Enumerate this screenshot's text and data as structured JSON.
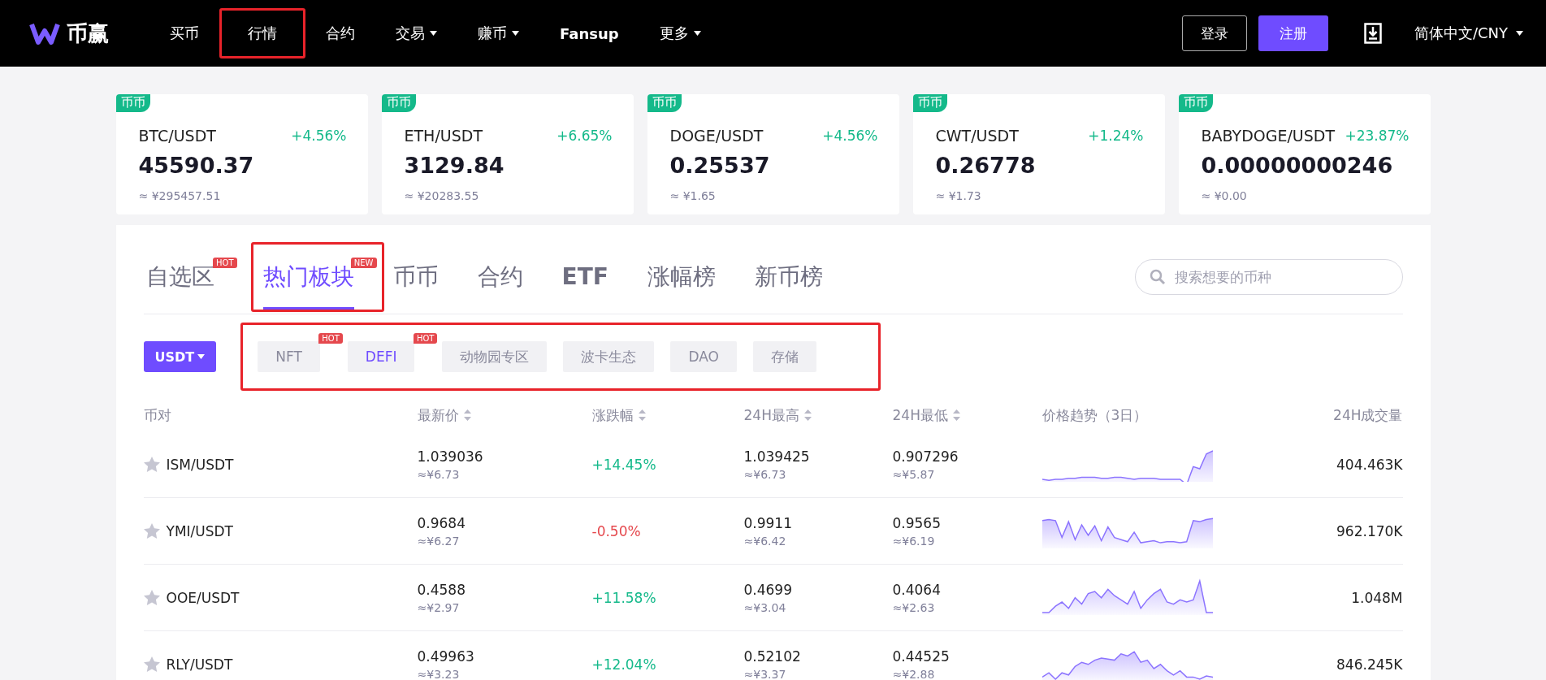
{
  "nav": {
    "logo": "币赢",
    "items": [
      {
        "label": "买币",
        "has_menu": false,
        "marked": false,
        "bold": false
      },
      {
        "label": "行情",
        "has_menu": false,
        "marked": true,
        "bold": false
      },
      {
        "label": "合约",
        "has_menu": false,
        "marked": false,
        "bold": false
      },
      {
        "label": "交易",
        "has_menu": true,
        "marked": false,
        "bold": false
      },
      {
        "label": "赚币",
        "has_menu": true,
        "marked": false,
        "bold": false
      },
      {
        "label": "Fansup",
        "has_menu": false,
        "marked": false,
        "bold": true
      },
      {
        "label": "更多",
        "has_menu": true,
        "marked": false,
        "bold": false
      }
    ],
    "login": "登录",
    "register": "注册",
    "language": "简体中文/CNY"
  },
  "tickers": [
    {
      "tag": "币币",
      "pair": "BTC/USDT",
      "change": "+4.56%",
      "price": "45590.37",
      "cny": "≈ ¥295457.51"
    },
    {
      "tag": "币币",
      "pair": "ETH/USDT",
      "change": "+6.65%",
      "price": "3129.84",
      "cny": "≈ ¥20283.55"
    },
    {
      "tag": "币币",
      "pair": "DOGE/USDT",
      "change": "+4.56%",
      "price": "0.25537",
      "cny": "≈ ¥1.65"
    },
    {
      "tag": "币币",
      "pair": "CWT/USDT",
      "change": "+1.24%",
      "price": "0.26778",
      "cny": "≈ ¥1.73"
    },
    {
      "tag": "币币",
      "pair": "BABYDOGE/USDT",
      "change": "+23.87%",
      "price": "0.00000000246",
      "cny": "≈ ¥0.00"
    }
  ],
  "tabs": [
    {
      "label": "自选区",
      "badge": "HOT",
      "selected": false,
      "marked": false,
      "bold": false
    },
    {
      "label": "热门板块",
      "badge": "NEW",
      "selected": true,
      "marked": true,
      "bold": false
    },
    {
      "label": "币币",
      "selected": false,
      "marked": false,
      "bold": false
    },
    {
      "label": "合约",
      "selected": false,
      "marked": false,
      "bold": false
    },
    {
      "label": "ETF",
      "selected": false,
      "marked": false,
      "bold": true
    },
    {
      "label": "涨幅榜",
      "selected": false,
      "marked": false,
      "bold": false
    },
    {
      "label": "新币榜",
      "selected": false,
      "marked": false,
      "bold": false
    }
  ],
  "search": {
    "placeholder": "搜索想要的币种"
  },
  "quote_selector": "USDT",
  "sectors": {
    "marked": true,
    "items": [
      {
        "label": "NFT",
        "badge": "HOT",
        "selected": false
      },
      {
        "label": "DEFI",
        "badge": "HOT",
        "selected": true
      },
      {
        "label": "动物园专区",
        "selected": false
      },
      {
        "label": "波卡生态",
        "selected": false
      },
      {
        "label": "DAO",
        "selected": false
      },
      {
        "label": "存储",
        "selected": false
      }
    ]
  },
  "table": {
    "columns": [
      {
        "label": "币对",
        "sortable": false
      },
      {
        "label": "最新价",
        "sortable": true
      },
      {
        "label": "涨跌幅",
        "sortable": true
      },
      {
        "label": "24H最高",
        "sortable": true
      },
      {
        "label": "24H最低",
        "sortable": true
      },
      {
        "label": "价格趋势（3日）",
        "sortable": false
      },
      {
        "label": "24H成交量",
        "sortable": false
      }
    ],
    "rows": [
      {
        "pair": "ISM/USDT",
        "favorite": false,
        "price": "1.039036",
        "price_cny": "≈¥6.73",
        "change": "+14.45%",
        "rising": true,
        "high": "1.039425",
        "high_cny": "≈¥6.73",
        "low": "0.907296",
        "low_cny": "≈¥5.87",
        "volume": "404.463K"
      },
      {
        "pair": "YMI/USDT",
        "favorite": false,
        "price": "0.9684",
        "price_cny": "≈¥6.27",
        "change": "-0.50%",
        "rising": false,
        "high": "0.9911",
        "high_cny": "≈¥6.42",
        "low": "0.9565",
        "low_cny": "≈¥6.19",
        "volume": "962.170K"
      },
      {
        "pair": "OOE/USDT",
        "favorite": false,
        "price": "0.4588",
        "price_cny": "≈¥2.97",
        "change": "+11.58%",
        "rising": true,
        "high": "0.4699",
        "high_cny": "≈¥3.04",
        "low": "0.4064",
        "low_cny": "≈¥2.63",
        "volume": "1.048M"
      },
      {
        "pair": "RLY/USDT",
        "favorite": false,
        "price": "0.49963",
        "price_cny": "≈¥3.23",
        "change": "+12.04%",
        "rising": true,
        "high": "0.52102",
        "high_cny": "≈¥3.37",
        "low": "0.44525",
        "low_cny": "≈¥2.88",
        "volume": "846.245K"
      }
    ]
  }
}
